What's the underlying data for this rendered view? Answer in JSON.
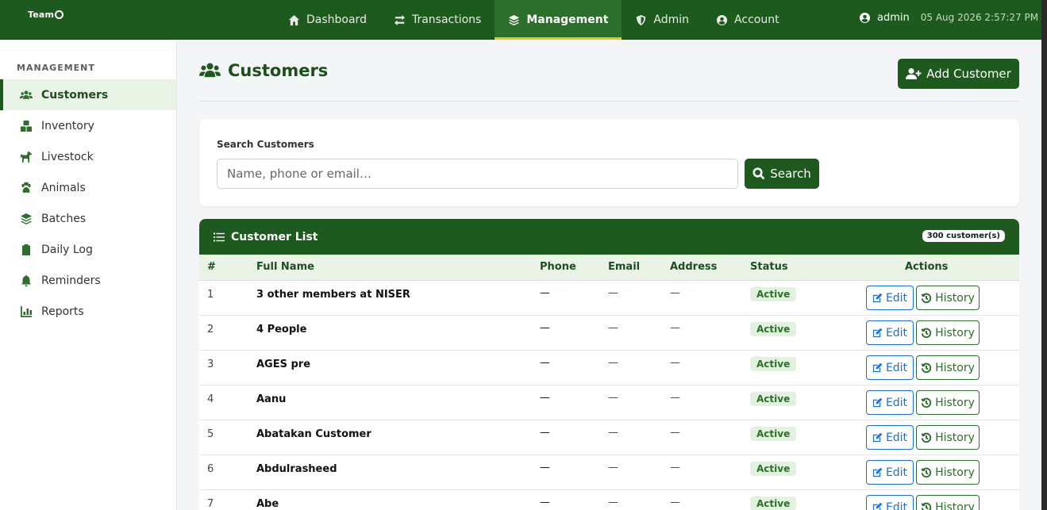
{
  "app": {
    "brand": "Team",
    "brand_sub": "O"
  },
  "nav": {
    "items": [
      {
        "label": "Dashboard",
        "icon": "home-icon"
      },
      {
        "label": "Transactions",
        "icon": "swap-arrows-icon"
      },
      {
        "label": "Management",
        "icon": "layers-icon",
        "active": true
      },
      {
        "label": "Admin",
        "icon": "shield-icon"
      },
      {
        "label": "Account",
        "icon": "user-circle-icon"
      }
    ],
    "user": "admin",
    "datetime": "05 Aug 2026 2:57:27 PM"
  },
  "sidebar": {
    "heading": "MANAGEMENT",
    "items": [
      {
        "label": "Customers",
        "icon": "users-icon",
        "active": true
      },
      {
        "label": "Inventory",
        "icon": "boxes-icon"
      },
      {
        "label": "Livestock",
        "icon": "horse-icon"
      },
      {
        "label": "Animals",
        "icon": "paw-icon"
      },
      {
        "label": "Batches",
        "icon": "layers-icon"
      },
      {
        "label": "Daily Log",
        "icon": "clipboard-icon"
      },
      {
        "label": "Reminders",
        "icon": "bell-icon"
      },
      {
        "label": "Reports",
        "icon": "chart-icon"
      }
    ]
  },
  "page": {
    "title": "Customers",
    "add_button": "Add Customer"
  },
  "search": {
    "label": "Search Customers",
    "placeholder": "Name, phone or email…",
    "value": "",
    "button": "Search"
  },
  "list": {
    "title": "Customer List",
    "count_badge": "300 customer(s)",
    "columns": [
      "#",
      "Full Name",
      "Phone",
      "Email",
      "Address",
      "Status",
      "Actions"
    ],
    "rows": [
      {
        "num": "1",
        "name": "3 other members at NISER",
        "phone": "—",
        "email": "—",
        "address": "—",
        "status": "Active"
      },
      {
        "num": "2",
        "name": "4 People",
        "phone": "—",
        "email": "—",
        "address": "—",
        "status": "Active"
      },
      {
        "num": "3",
        "name": "AGES pre",
        "phone": "—",
        "email": "—",
        "address": "—",
        "status": "Active"
      },
      {
        "num": "4",
        "name": "Aanu",
        "phone": "—",
        "email": "—",
        "address": "—",
        "status": "Active"
      },
      {
        "num": "5",
        "name": "Abatakan Customer",
        "phone": "—",
        "email": "—",
        "address": "—",
        "status": "Active"
      },
      {
        "num": "6",
        "name": "Abdulrasheed",
        "phone": "—",
        "email": "—",
        "address": "—",
        "status": "Active"
      },
      {
        "num": "7",
        "name": "Abe",
        "phone": "—",
        "email": "—",
        "address": "—",
        "status": "Active"
      }
    ],
    "edit_label": "Edit",
    "history_label": "History"
  },
  "colors": {
    "primary": "#1e5a1e",
    "accent": "#f0c419",
    "edit": "#1f6fd1",
    "active_bg": "#e9f4e7"
  }
}
